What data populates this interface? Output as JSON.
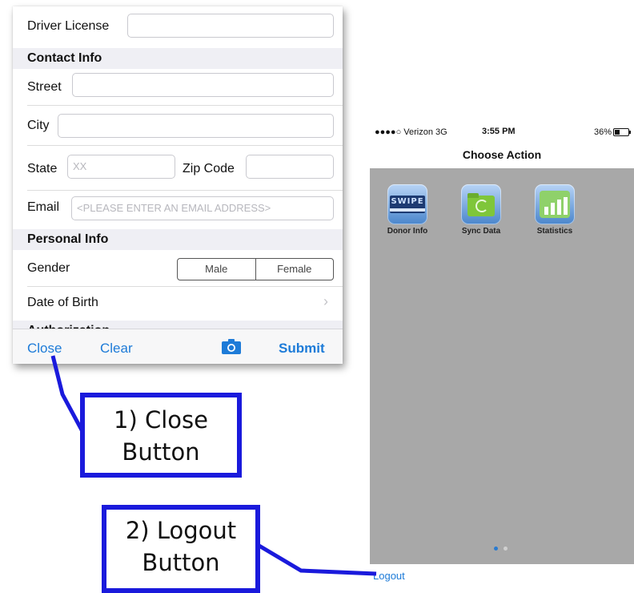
{
  "form": {
    "driver_license_label": "Driver License",
    "contact_header": "Contact Info",
    "street_label": "Street",
    "city_label": "City",
    "state_label": "State",
    "state_placeholder": "XX",
    "zip_label": "Zip Code",
    "email_label": "Email",
    "email_placeholder": "<PLEASE ENTER AN EMAIL ADDRESS>",
    "personal_header": "Personal Info",
    "gender_label": "Gender",
    "gender_options": [
      "Male",
      "Female"
    ],
    "dob_label": "Date of Birth",
    "next_header_partial": "Authorization",
    "toolbar": {
      "close": "Close",
      "clear": "Clear",
      "camera_icon": "camera-icon",
      "submit": "Submit"
    }
  },
  "phone": {
    "status": {
      "carrier": "●●●●○ Verizon  3G",
      "time": "3:55 PM",
      "battery": "36%"
    },
    "title": "Choose Action",
    "apps": [
      {
        "label": "Donor Info",
        "icon": "swipe-card-icon",
        "icon_text": "SWIPE"
      },
      {
        "label": "Sync Data",
        "icon": "sync-folder-icon"
      },
      {
        "label": "Statistics",
        "icon": "bar-chart-icon"
      }
    ],
    "page_dots": {
      "count": 2,
      "active": 0
    },
    "logout": "Logout"
  },
  "callouts": {
    "close": {
      "line1": "1) Close",
      "line2": "Button"
    },
    "logout": {
      "line1": "2) Logout",
      "line2": "Button"
    }
  },
  "colors": {
    "accent_blue": "#1d7bd8",
    "callout_blue": "#1a1adc",
    "phone_bg": "#a8a8a8"
  }
}
